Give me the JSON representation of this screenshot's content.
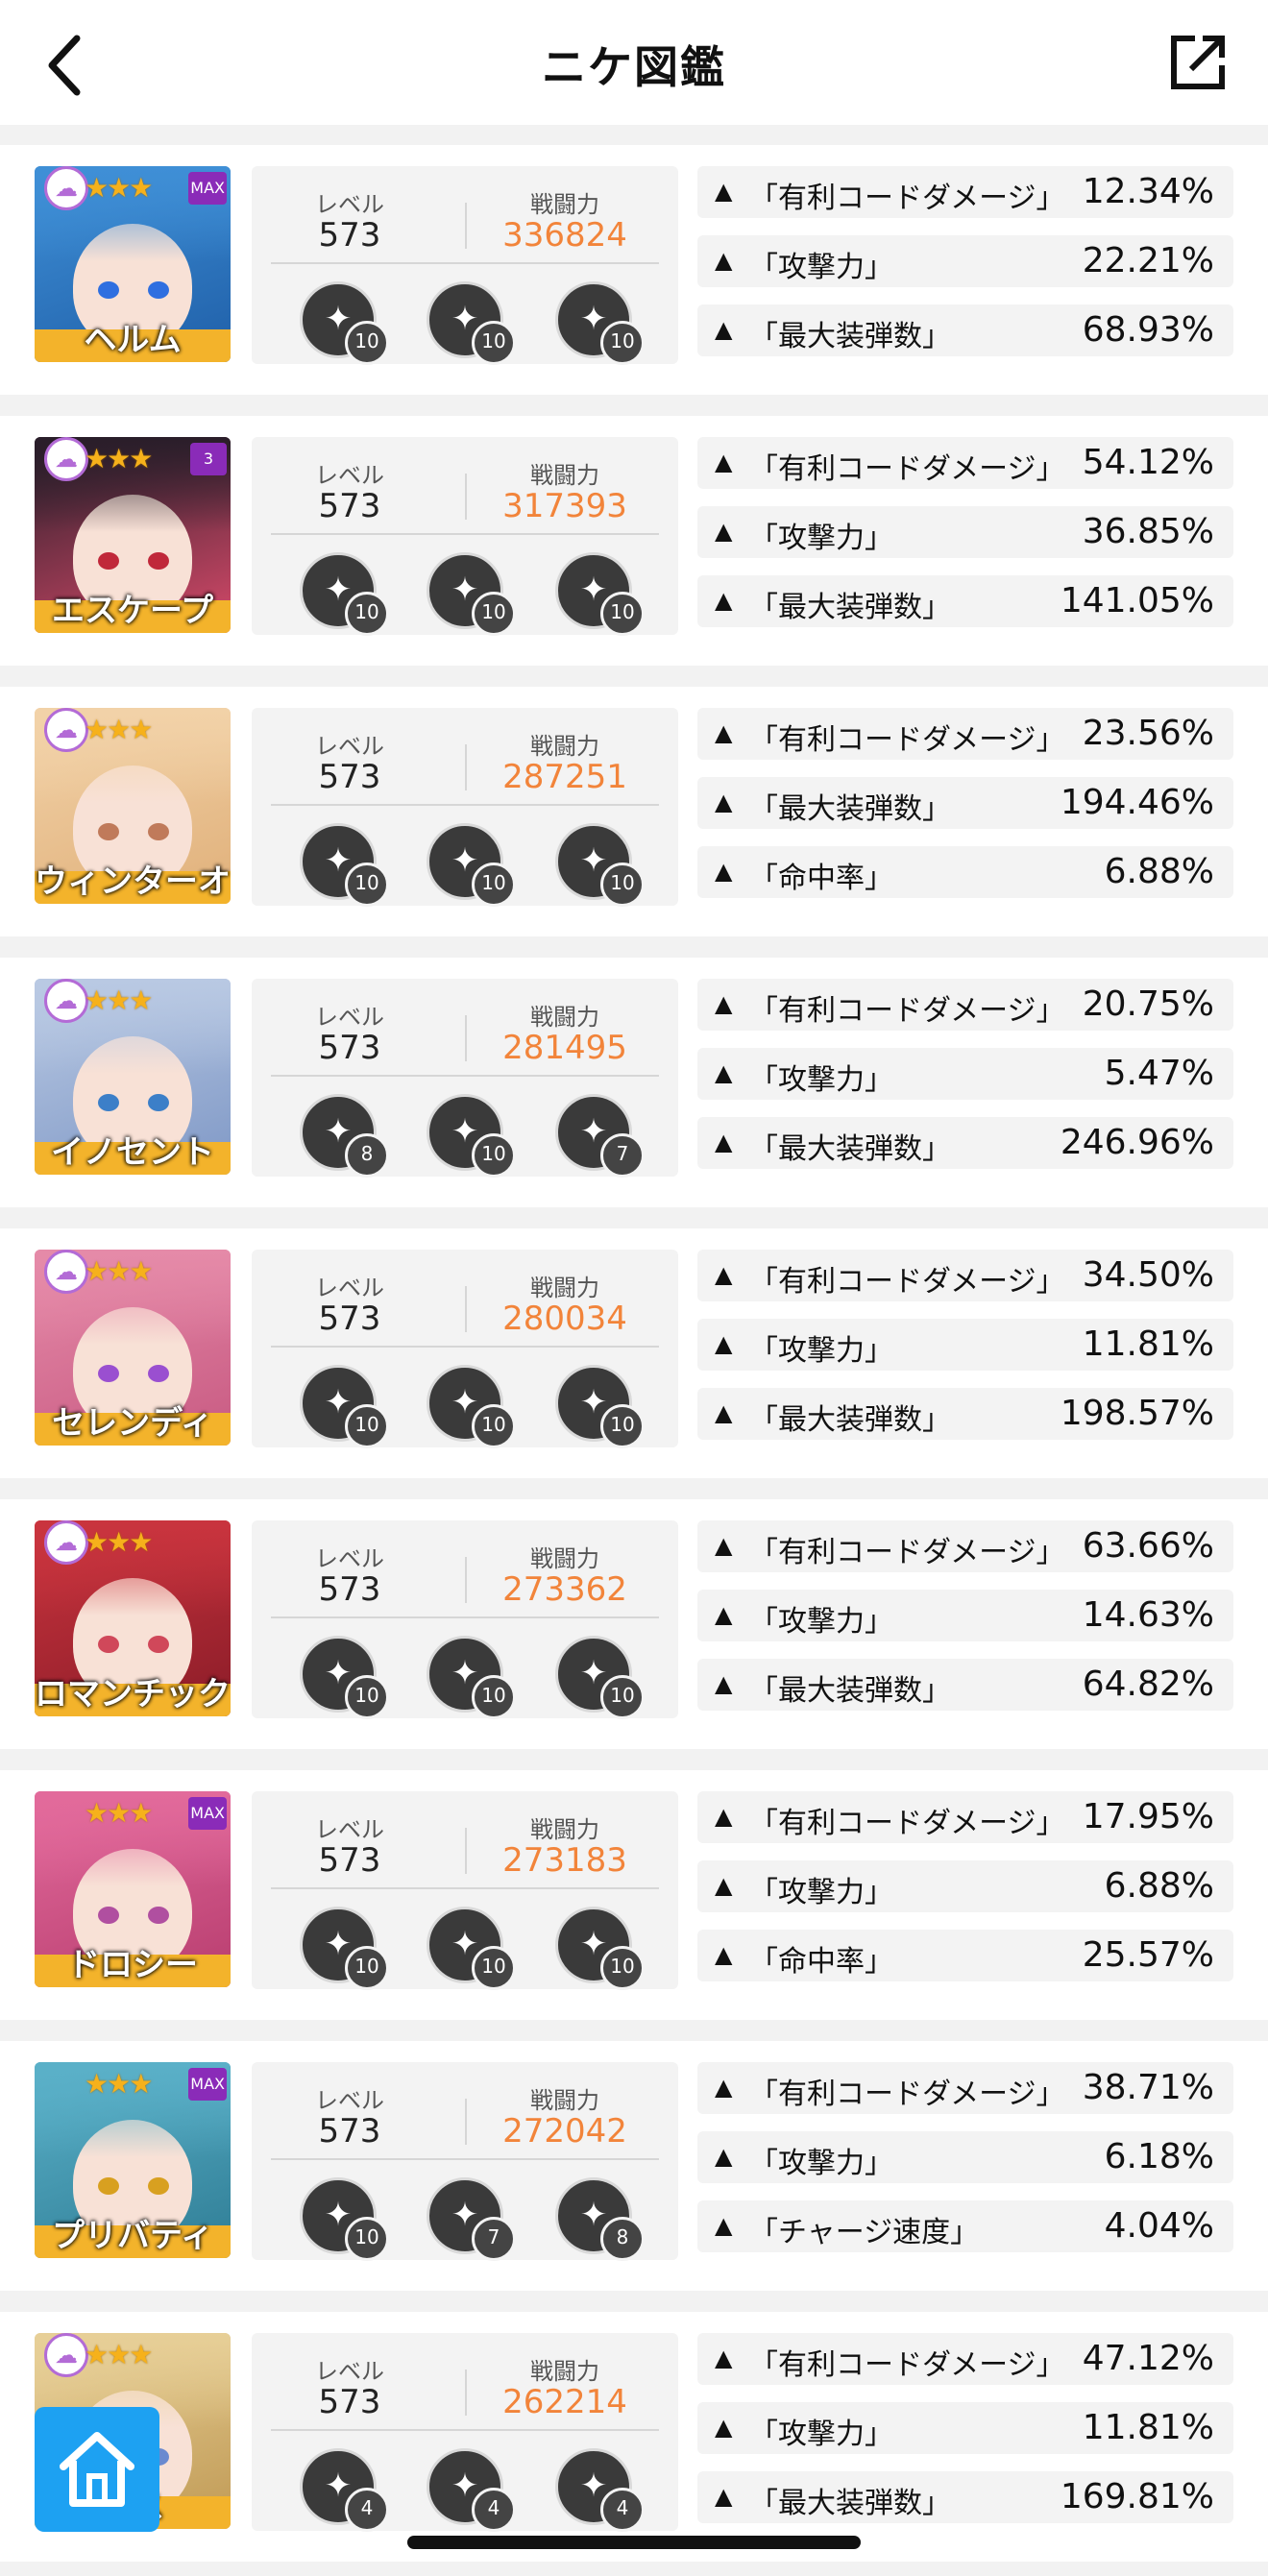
{
  "header": {
    "title": "ニケ図鑑",
    "back_icon": "chevron-left-icon",
    "share_icon": "external-link-icon"
  },
  "labels": {
    "level": "レベル",
    "power": "戦闘力"
  },
  "colors": {
    "power": "#f2843a",
    "burst_bar": "#f3b32b",
    "home_button": "#1da1f2"
  },
  "nikke": [
    {
      "name": "ヘルム",
      "class_icon": "burst-cloud-icon",
      "stars": "★★★",
      "badge": "MAX",
      "level": "573",
      "power": "336824",
      "skills": [
        {
          "icon": "skill-icon",
          "level": "10"
        },
        {
          "icon": "skill-icon",
          "level": "10"
        },
        {
          "icon": "skill-icon",
          "level": "10"
        }
      ],
      "effects": [
        {
          "name": "「有利コードダメージ」",
          "value": "12.34%"
        },
        {
          "name": "「攻撃力」",
          "value": "22.21%"
        },
        {
          "name": "「最大装弾数」",
          "value": "68.93%"
        }
      ]
    },
    {
      "name": "エスケープ",
      "class_icon": "burst-cloud-icon",
      "stars": "★★★",
      "badge": "3",
      "level": "573",
      "power": "317393",
      "skills": [
        {
          "icon": "skill-icon",
          "level": "10"
        },
        {
          "icon": "skill-icon",
          "level": "10"
        },
        {
          "icon": "skill-icon",
          "level": "10"
        }
      ],
      "effects": [
        {
          "name": "「有利コードダメージ」",
          "value": "54.12%"
        },
        {
          "name": "「攻撃力」",
          "value": "36.85%"
        },
        {
          "name": "「最大装弾数」",
          "value": "141.05%"
        }
      ]
    },
    {
      "name": "ウィンターオ",
      "class_icon": "burst-cloud-icon",
      "stars": "★★★",
      "badge": "",
      "level": "573",
      "power": "287251",
      "skills": [
        {
          "icon": "skill-icon",
          "level": "10"
        },
        {
          "icon": "skill-icon",
          "level": "10"
        },
        {
          "icon": "skill-icon",
          "level": "10"
        }
      ],
      "effects": [
        {
          "name": "「有利コードダメージ」",
          "value": "23.56%"
        },
        {
          "name": "「最大装弾数」",
          "value": "194.46%"
        },
        {
          "name": "「命中率」",
          "value": "6.88%"
        }
      ]
    },
    {
      "name": "イノセント",
      "class_icon": "burst-cloud-icon",
      "stars": "★★★",
      "badge": "",
      "level": "573",
      "power": "281495",
      "skills": [
        {
          "icon": "skill-icon",
          "level": "8"
        },
        {
          "icon": "skill-icon",
          "level": "10"
        },
        {
          "icon": "skill-icon",
          "level": "7"
        }
      ],
      "effects": [
        {
          "name": "「有利コードダメージ」",
          "value": "20.75%"
        },
        {
          "name": "「攻撃力」",
          "value": "5.47%"
        },
        {
          "name": "「最大装弾数」",
          "value": "246.96%"
        }
      ]
    },
    {
      "name": "セレンディ",
      "class_icon": "burst-cloud-icon",
      "stars": "★★★",
      "badge": "",
      "level": "573",
      "power": "280034",
      "skills": [
        {
          "icon": "skill-icon",
          "level": "10"
        },
        {
          "icon": "skill-icon",
          "level": "10"
        },
        {
          "icon": "skill-icon",
          "level": "10"
        }
      ],
      "effects": [
        {
          "name": "「有利コードダメージ」",
          "value": "34.50%"
        },
        {
          "name": "「攻撃力」",
          "value": "11.81%"
        },
        {
          "name": "「最大装弾数」",
          "value": "198.57%"
        }
      ]
    },
    {
      "name": "ロマンチック",
      "class_icon": "burst-cloud-icon",
      "stars": "★★★",
      "badge": "",
      "level": "573",
      "power": "273362",
      "skills": [
        {
          "icon": "skill-icon",
          "level": "10"
        },
        {
          "icon": "skill-icon",
          "level": "10"
        },
        {
          "icon": "skill-icon",
          "level": "10"
        }
      ],
      "effects": [
        {
          "name": "「有利コードダメージ」",
          "value": "63.66%"
        },
        {
          "name": "「攻撃力」",
          "value": "14.63%"
        },
        {
          "name": "「最大装弾数」",
          "value": "64.82%"
        }
      ]
    },
    {
      "name": "ドロシー",
      "class_icon": "",
      "stars": "★★★",
      "badge": "MAX",
      "level": "573",
      "power": "273183",
      "skills": [
        {
          "icon": "skill-icon",
          "level": "10"
        },
        {
          "icon": "skill-icon",
          "level": "10"
        },
        {
          "icon": "skill-icon",
          "level": "10"
        }
      ],
      "effects": [
        {
          "name": "「有利コードダメージ」",
          "value": "17.95%"
        },
        {
          "name": "「攻撃力」",
          "value": "6.88%"
        },
        {
          "name": "「命中率」",
          "value": "25.57%"
        }
      ]
    },
    {
      "name": "プリバティ",
      "class_icon": "",
      "stars": "★★★",
      "badge": "MAX",
      "level": "573",
      "power": "272042",
      "skills": [
        {
          "icon": "skill-icon",
          "level": "10"
        },
        {
          "icon": "skill-icon",
          "level": "7"
        },
        {
          "icon": "skill-icon",
          "level": "8"
        }
      ],
      "effects": [
        {
          "name": "「有利コードダメージ」",
          "value": "38.71%"
        },
        {
          "name": "「攻撃力」",
          "value": "6.18%"
        },
        {
          "name": "「チャージ速度」",
          "value": "4.04%"
        }
      ]
    },
    {
      "name": "ース",
      "class_icon": "burst-cloud-icon",
      "stars": "★★★",
      "badge": "",
      "level": "573",
      "power": "262214",
      "skills": [
        {
          "icon": "skill-icon",
          "level": "4"
        },
        {
          "icon": "skill-icon",
          "level": "4"
        },
        {
          "icon": "skill-icon",
          "level": "4"
        }
      ],
      "effects": [
        {
          "name": "「有利コードダメージ」",
          "value": "47.12%"
        },
        {
          "name": "「攻撃力」",
          "value": "11.81%"
        },
        {
          "name": "「最大装弾数」",
          "value": "169.81%"
        }
      ]
    }
  ],
  "home_button_icon": "home-icon"
}
